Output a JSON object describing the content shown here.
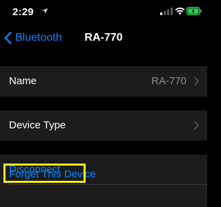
{
  "status_bar": {
    "time": "2:29",
    "icons": [
      "location-arrow-icon",
      "cellular-signal-icon",
      "wifi-icon",
      "battery-charging-icon"
    ],
    "battery_color": "#30d158"
  },
  "nav": {
    "back_label": "Bluetooth",
    "title": "RA-770",
    "accent_color": "#0a84ff"
  },
  "rows": {
    "name": {
      "label": "Name",
      "value": "RA-770"
    },
    "device_type": {
      "label": "Device Type"
    },
    "disconnect": {
      "label": "Disconnect"
    },
    "forget": {
      "label": "Forget This Device"
    }
  },
  "highlight_color": "#f6ec10"
}
